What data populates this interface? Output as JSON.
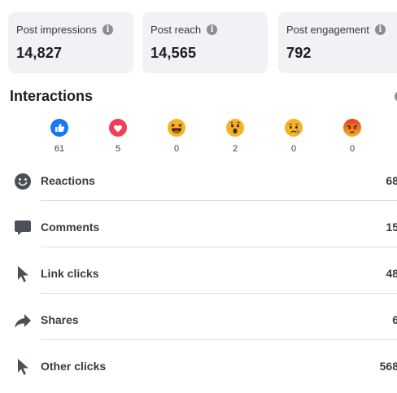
{
  "metrics": [
    {
      "label": "Post impressions",
      "value": "14,827"
    },
    {
      "label": "Post reach",
      "value": "14,565"
    },
    {
      "label": "Post engagement",
      "value": "792"
    }
  ],
  "interactions": {
    "title": "Interactions",
    "reactions": [
      {
        "name": "like",
        "count": "61",
        "color": "#1877f2",
        "icon": "like-icon"
      },
      {
        "name": "love",
        "count": "5",
        "color": "#f33e58",
        "icon": "love-icon"
      },
      {
        "name": "haha",
        "count": "0",
        "color": "#f7b125",
        "icon": "haha-icon"
      },
      {
        "name": "wow",
        "count": "2",
        "color": "#f7b125",
        "icon": "wow-icon"
      },
      {
        "name": "sad",
        "count": "0",
        "color": "#f7b125",
        "icon": "sad-icon"
      },
      {
        "name": "angry",
        "count": "0",
        "color": "#e9710f",
        "icon": "angry-icon"
      }
    ],
    "rows": [
      {
        "label": "Reactions",
        "value": "68",
        "icon": "smiley-icon"
      },
      {
        "label": "Comments",
        "value": "15",
        "icon": "comment-icon"
      },
      {
        "label": "Link clicks",
        "value": "48",
        "icon": "cursor-icon"
      },
      {
        "label": "Shares",
        "value": "6",
        "icon": "share-icon"
      },
      {
        "label": "Other clicks",
        "value": "568",
        "icon": "cursor-icon"
      }
    ]
  },
  "info_glyph": "i"
}
